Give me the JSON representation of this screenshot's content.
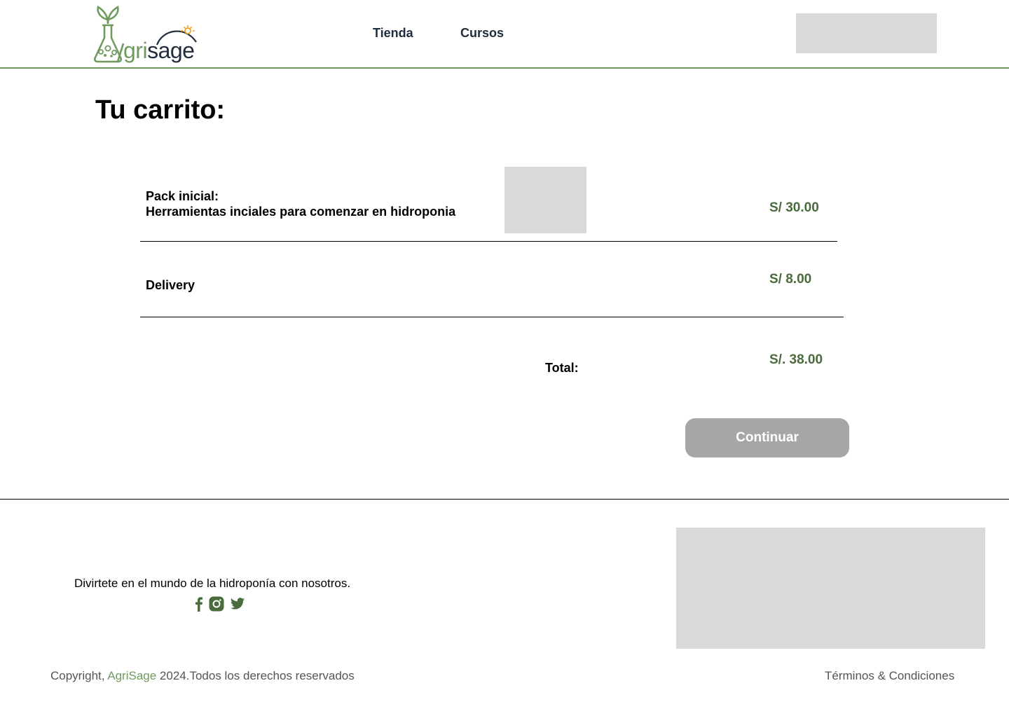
{
  "colors": {
    "brand_green": "#6f9a5e",
    "price_green": "#4a6b3b",
    "nav_text": "#1f2d3d",
    "button_gray": "#a6a6a6",
    "placeholder_gray": "#d9d9d9",
    "sun_orange": "#f0a31d"
  },
  "header": {
    "logo_prefix": "grisage",
    "nav": [
      {
        "label": "Tienda"
      },
      {
        "label": "Cursos"
      }
    ]
  },
  "main": {
    "title": "Tu carrito:",
    "items": [
      {
        "title": "Pack inicial:",
        "description": "Herramientas inciales para comenzar en hidroponia",
        "price": "S/ 30.00"
      },
      {
        "title": "Delivery",
        "price": "S/ 8.00"
      }
    ],
    "total_label": "Total:",
    "total_price": "S/. 38.00",
    "continue_label": "Continuar"
  },
  "footer": {
    "tagline": "Divirtete en el mundo de la hidroponía con nosotros.",
    "social_icons": [
      "facebook-icon",
      "instagram-icon",
      "twitter-icon"
    ],
    "copyright_prefix": "Copyright, ",
    "copyright_brand": "AgriSage",
    "copyright_suffix": " 2024.Todos los derechos reservados",
    "terms_label": "Términos & Condiciones"
  }
}
